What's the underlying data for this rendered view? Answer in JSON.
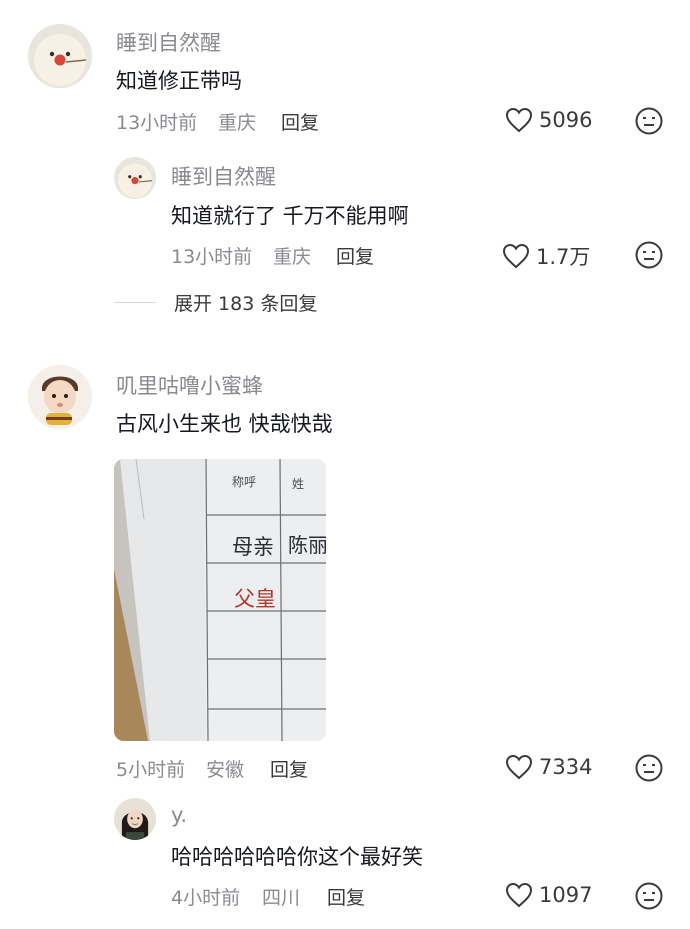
{
  "comments": [
    {
      "user": "睡到自然醒",
      "text": "知道修正带吗",
      "time": "13小时前",
      "location": "重庆",
      "reply_label": "回复",
      "likes": "5096"
    },
    {
      "user": "睡到自然醒",
      "text": "知道就行了  千万不能用啊",
      "time": "13小时前",
      "location": "重庆",
      "reply_label": "回复",
      "likes": "1.7万"
    },
    {
      "user": "叽里咕噜小蜜蜂",
      "text": "古风小生来也   快哉快哉",
      "time": "5小时前",
      "location": "安徽",
      "reply_label": "回复",
      "likes": "7334",
      "photo": {
        "header1": "称呼",
        "header2": "姓",
        "cell1": "母亲",
        "cell2": "陈丽",
        "cell3": "父皇"
      }
    },
    {
      "user": "y.",
      "text": "哈哈哈哈哈哈你这个最好笑",
      "time": "4小时前",
      "location": "四川",
      "reply_label": "回复",
      "likes": "1097"
    }
  ],
  "expand_replies": "展开 183 条回复",
  "icons": {
    "like": "heart-outline-icon",
    "dislike": "meh-face-icon"
  },
  "colors": {
    "meta_gray": "#8a8b91",
    "text_dark": "#161823",
    "avatar_cream": "#f1ece0",
    "avatar_nose": "#d8463a"
  }
}
